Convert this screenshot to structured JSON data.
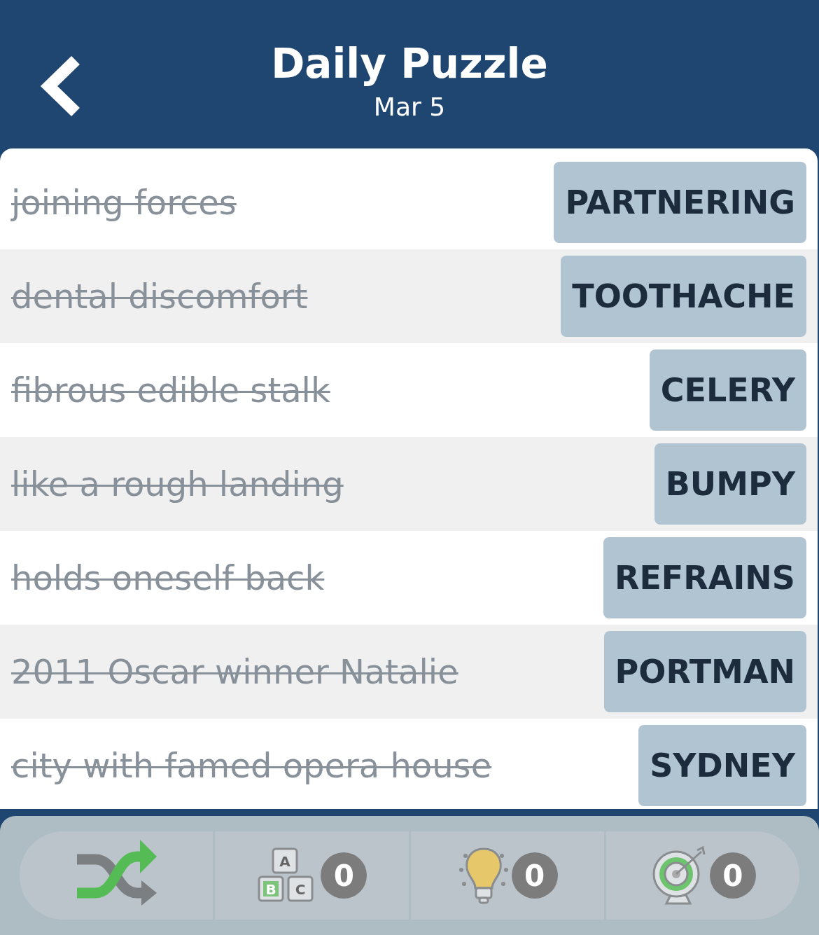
{
  "header": {
    "title": "Daily Puzzle",
    "date": "Mar 5"
  },
  "clues": [
    {
      "clue": "joining forces",
      "answer": "PARTNERING",
      "solved": true
    },
    {
      "clue": "dental discomfort",
      "answer": "TOOTHACHE",
      "solved": true
    },
    {
      "clue": "fibrous edible stalk",
      "answer": "CELERY",
      "solved": true
    },
    {
      "clue": "like a rough landing",
      "answer": "BUMPY",
      "solved": true
    },
    {
      "clue": "holds oneself back",
      "answer": "REFRAINS",
      "solved": true
    },
    {
      "clue": "2011 Oscar winner Natalie",
      "answer": "PORTMAN",
      "solved": true
    },
    {
      "clue": "city with famed opera house",
      "answer": "SYDNEY",
      "solved": true
    }
  ],
  "tools": [
    {
      "kind": "shuffle"
    },
    {
      "kind": "letters",
      "letters": [
        "A",
        "B",
        "C"
      ],
      "count": "0"
    },
    {
      "kind": "hint",
      "count": "0"
    },
    {
      "kind": "target",
      "count": "0"
    }
  ]
}
